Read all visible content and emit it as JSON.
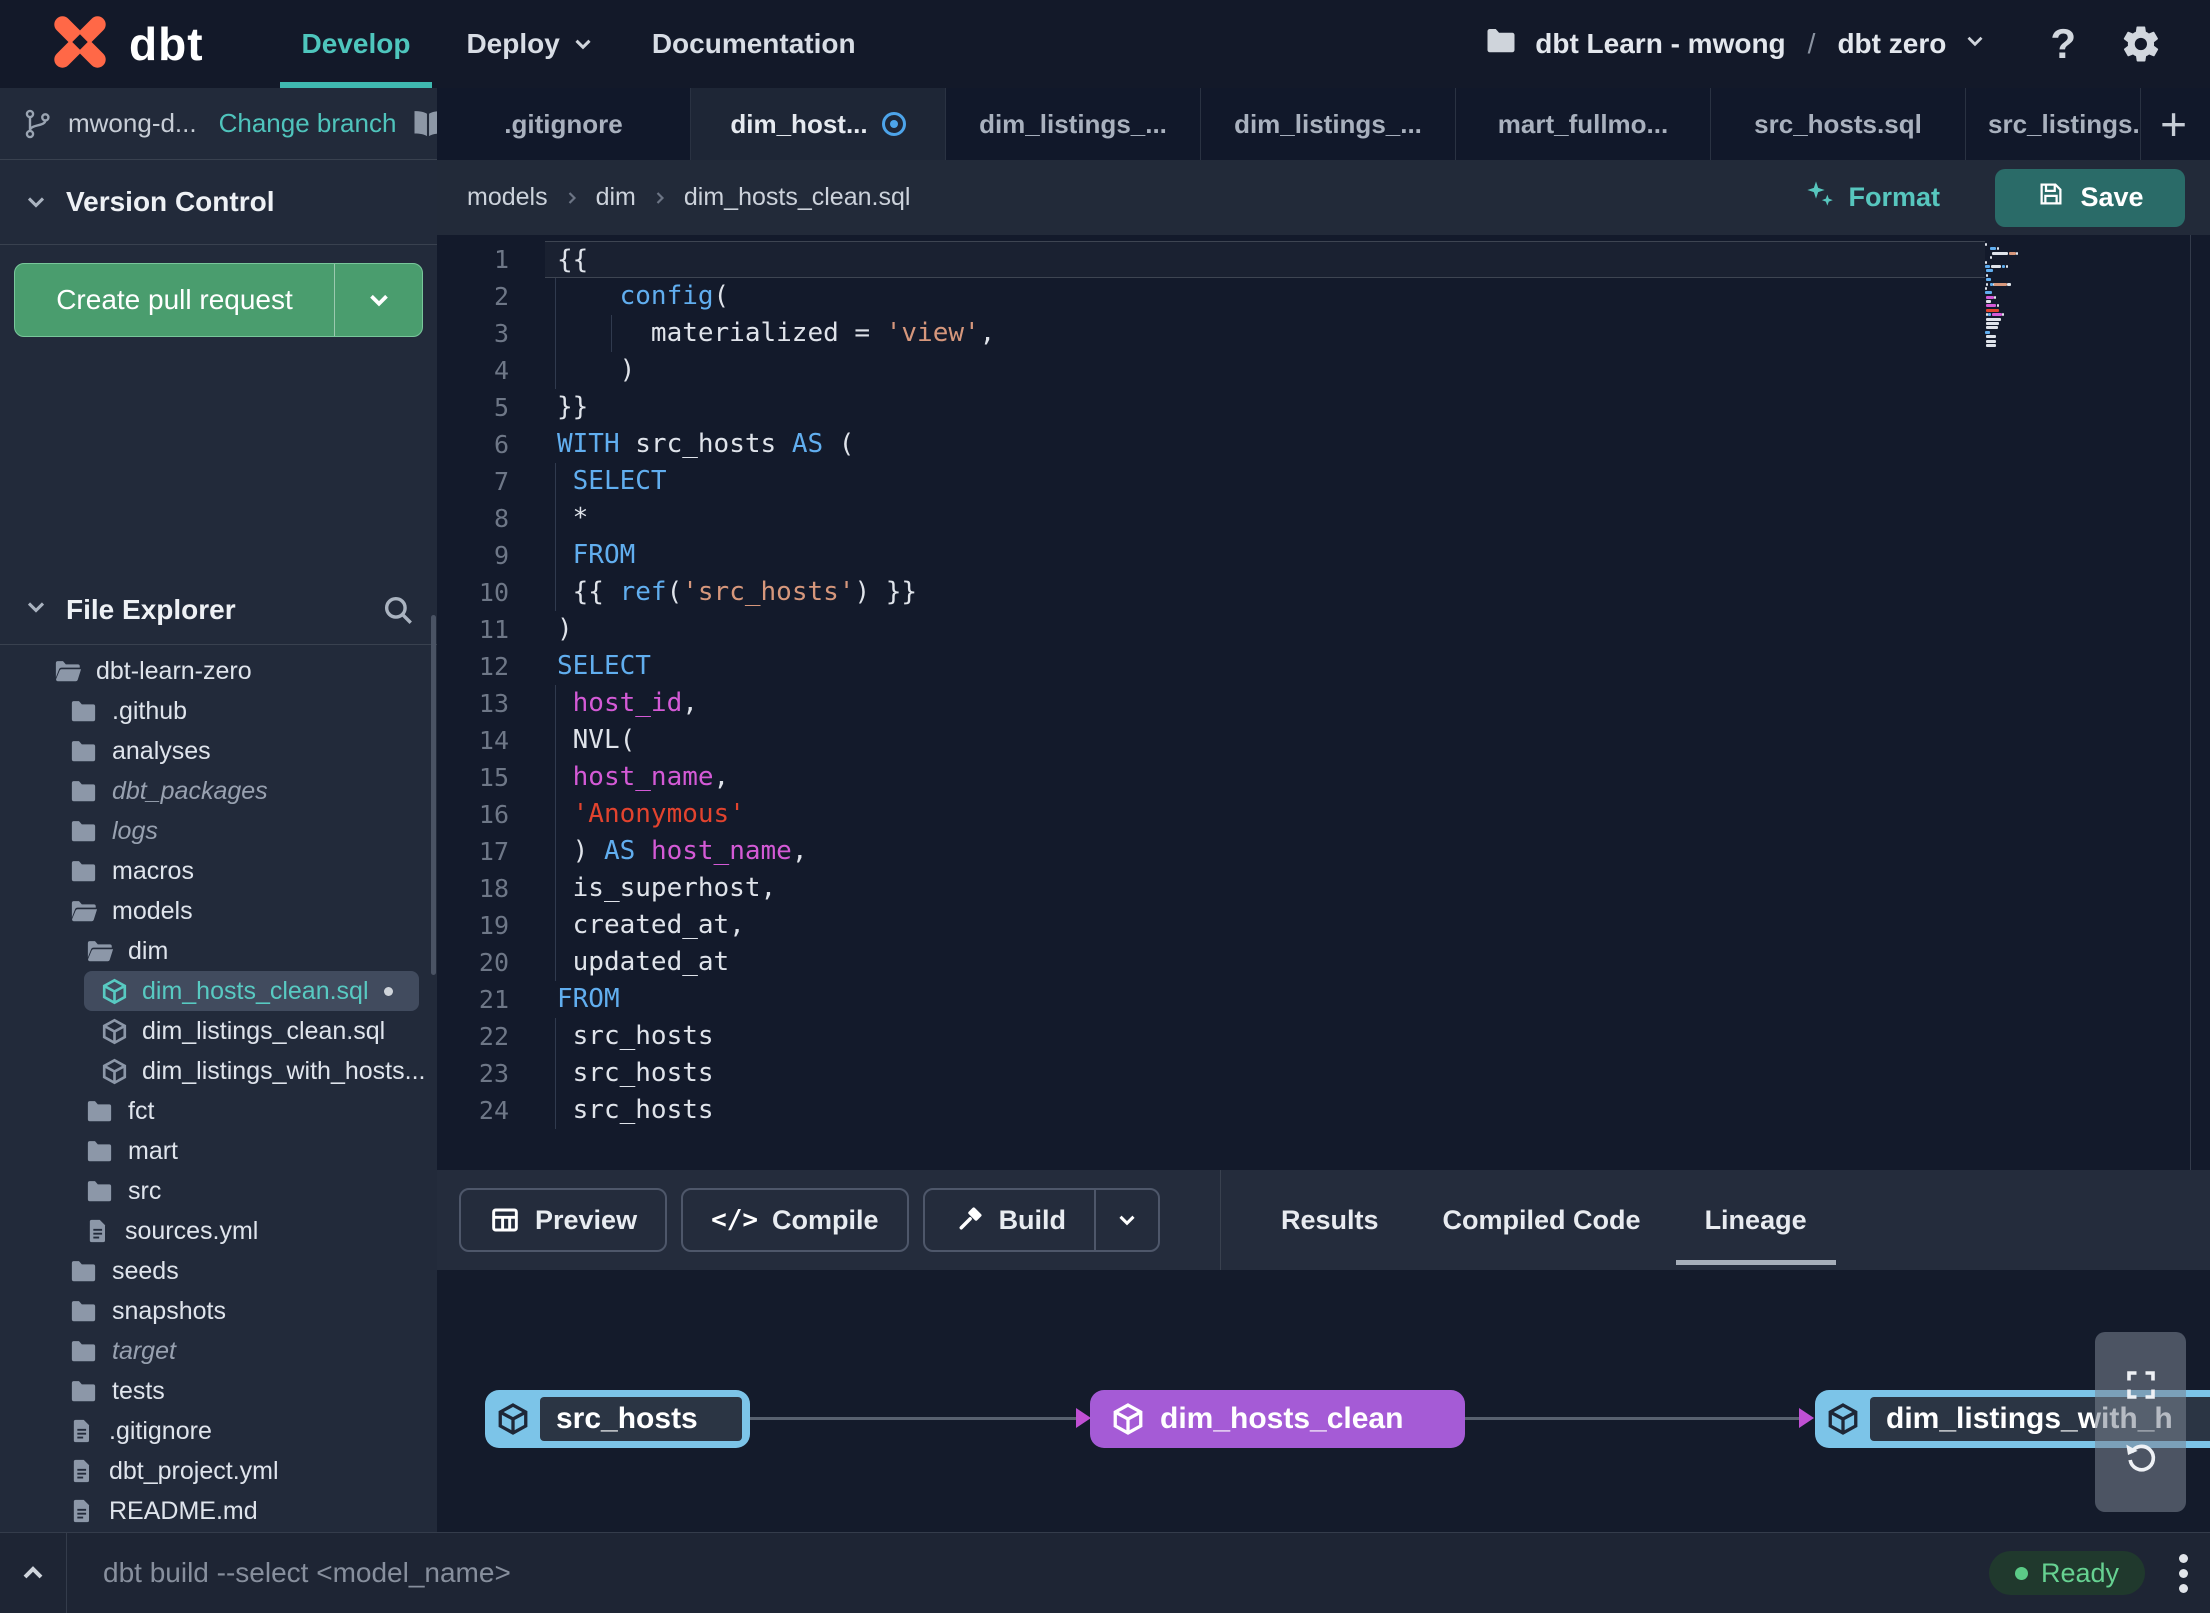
{
  "navbar": {
    "logo_text": "dbt",
    "menu": [
      {
        "label": "Develop",
        "active": true,
        "chevron": false
      },
      {
        "label": "Deploy",
        "active": false,
        "chevron": true
      },
      {
        "label": "Documentation",
        "active": false,
        "chevron": false
      }
    ],
    "project_name": "dbt Learn - mwong",
    "path_separator": "/",
    "environment_name": "dbt zero",
    "help_label": "?"
  },
  "sidebar": {
    "branch_name": "mwong-d...",
    "change_branch_label": "Change branch",
    "version_control_title": "Version Control",
    "create_pull_request_label": "Create pull request",
    "file_explorer_title": "File Explorer",
    "tree": [
      {
        "label": "dbt-learn-zero",
        "type": "folder-open",
        "level": 0
      },
      {
        "label": ".github",
        "type": "folder",
        "level": 1
      },
      {
        "label": "analyses",
        "type": "folder",
        "level": 1
      },
      {
        "label": "dbt_packages",
        "type": "folder",
        "level": 1,
        "italic": true
      },
      {
        "label": "logs",
        "type": "folder",
        "level": 1,
        "italic": true
      },
      {
        "label": "macros",
        "type": "folder",
        "level": 1
      },
      {
        "label": "models",
        "type": "folder-open",
        "level": 1
      },
      {
        "label": "dim",
        "type": "folder-open",
        "level": 2
      },
      {
        "label": "dim_hosts_clean.sql",
        "type": "model",
        "level": 3,
        "selected": true,
        "modified": true
      },
      {
        "label": "dim_listings_clean.sql",
        "type": "model",
        "level": 3
      },
      {
        "label": "dim_listings_with_hosts...",
        "type": "model",
        "level": 3
      },
      {
        "label": "fct",
        "type": "folder",
        "level": 2
      },
      {
        "label": "mart",
        "type": "folder",
        "level": 2
      },
      {
        "label": "src",
        "type": "folder",
        "level": 2
      },
      {
        "label": "sources.yml",
        "type": "file",
        "level": 2
      },
      {
        "label": "seeds",
        "type": "folder",
        "level": 1
      },
      {
        "label": "snapshots",
        "type": "folder",
        "level": 1
      },
      {
        "label": "target",
        "type": "folder",
        "level": 1,
        "italic": true
      },
      {
        "label": "tests",
        "type": "folder",
        "level": 1
      },
      {
        "label": ".gitignore",
        "type": "file",
        "level": 1
      },
      {
        "label": "dbt_project.yml",
        "type": "file",
        "level": 1
      },
      {
        "label": "README.md",
        "type": "file",
        "level": 1
      }
    ]
  },
  "editor": {
    "tabs": [
      {
        "label": ".gitignore"
      },
      {
        "label": "dim_host...",
        "active": true,
        "modified": true
      },
      {
        "label": "dim_listings_..."
      },
      {
        "label": "dim_listings_..."
      },
      {
        "label": "mart_fullmo..."
      },
      {
        "label": "src_hosts.sql"
      },
      {
        "label": "src_listings.",
        "clipped": true
      }
    ],
    "new_tab_label": "+",
    "breadcrumb": [
      "models",
      "dim",
      "dim_hosts_clean.sql"
    ],
    "format_label": "Format",
    "save_label": "Save",
    "code": {
      "token_colors": {
        "p": "#dfe3ea",
        "k": "#61aeef",
        "f": "#d45ad6",
        "s": "#d6977c",
        "r": "#e2432e"
      },
      "lines": [
        {
          "n": 1,
          "current": true,
          "guides": [],
          "t": [
            [
              "{{",
              "p"
            ]
          ]
        },
        {
          "n": 2,
          "guides": [
            0
          ],
          "t": [
            [
              "    ",
              "p"
            ],
            [
              "config",
              "k"
            ],
            [
              "(",
              "p"
            ]
          ]
        },
        {
          "n": 3,
          "guides": [
            0,
            1
          ],
          "t": [
            [
              "      materialized = ",
              "p"
            ],
            [
              "'view'",
              "s"
            ],
            [
              ",",
              "p"
            ]
          ]
        },
        {
          "n": 4,
          "guides": [
            0
          ],
          "t": [
            [
              "    )",
              "p"
            ]
          ]
        },
        {
          "n": 5,
          "guides": [],
          "t": [
            [
              "}}",
              "p"
            ]
          ]
        },
        {
          "n": 6,
          "guides": [],
          "t": [
            [
              "WITH",
              "k"
            ],
            [
              " src_hosts ",
              "p"
            ],
            [
              "AS",
              "k"
            ],
            [
              " (",
              "p"
            ]
          ]
        },
        {
          "n": 7,
          "guides": [
            0
          ],
          "t": [
            [
              " ",
              "p"
            ],
            [
              "SELECT",
              "k"
            ]
          ]
        },
        {
          "n": 8,
          "guides": [
            0
          ],
          "t": [
            [
              " *",
              "p"
            ]
          ]
        },
        {
          "n": 9,
          "guides": [
            0
          ],
          "t": [
            [
              " ",
              "p"
            ],
            [
              "FROM",
              "k"
            ]
          ]
        },
        {
          "n": 10,
          "guides": [
            0
          ],
          "t": [
            [
              " {{ ",
              "p"
            ],
            [
              "ref",
              "k"
            ],
            [
              "(",
              "p"
            ],
            [
              "'src_hosts'",
              "s"
            ],
            [
              ") }}",
              "p"
            ]
          ]
        },
        {
          "n": 11,
          "guides": [],
          "t": [
            [
              ")",
              "p"
            ]
          ]
        },
        {
          "n": 12,
          "guides": [],
          "t": [
            [
              "SELECT",
              "k"
            ]
          ]
        },
        {
          "n": 13,
          "guides": [
            0
          ],
          "t": [
            [
              " ",
              "p"
            ],
            [
              "host_id",
              "f"
            ],
            [
              ",",
              "p"
            ]
          ]
        },
        {
          "n": 14,
          "guides": [
            0
          ],
          "t": [
            [
              " NVL(",
              "p"
            ]
          ]
        },
        {
          "n": 15,
          "guides": [
            0
          ],
          "t": [
            [
              " ",
              "p"
            ],
            [
              "host_name",
              "f"
            ],
            [
              ",",
              "p"
            ]
          ]
        },
        {
          "n": 16,
          "guides": [
            0
          ],
          "t": [
            [
              " ",
              "p"
            ],
            [
              "'Anonymous'",
              "r"
            ]
          ]
        },
        {
          "n": 17,
          "guides": [
            0
          ],
          "t": [
            [
              " ) ",
              "p"
            ],
            [
              "AS",
              "k"
            ],
            [
              " ",
              "p"
            ],
            [
              "host_name",
              "f"
            ],
            [
              ",",
              "p"
            ]
          ]
        },
        {
          "n": 18,
          "guides": [
            0
          ],
          "t": [
            [
              " is_superhost,",
              "p"
            ]
          ]
        },
        {
          "n": 19,
          "guides": [
            0
          ],
          "t": [
            [
              " created_at,",
              "p"
            ]
          ]
        },
        {
          "n": 20,
          "guides": [
            0
          ],
          "t": [
            [
              " updated_at",
              "p"
            ]
          ]
        },
        {
          "n": 21,
          "guides": [],
          "t": [
            [
              "FROM",
              "k"
            ]
          ]
        },
        {
          "n": 22,
          "guides": [
            0
          ],
          "t": [
            [
              " src_hosts",
              "p"
            ]
          ]
        },
        {
          "n": 23,
          "guides": [
            0
          ],
          "t": [
            [
              " src_hosts",
              "p"
            ]
          ]
        },
        {
          "n": 24,
          "guides": [
            0
          ],
          "t": [
            [
              " src_hosts",
              "p"
            ]
          ]
        }
      ]
    }
  },
  "bottom_panel": {
    "actions": [
      {
        "label": "Preview",
        "icon": "grid"
      },
      {
        "label": "Compile",
        "icon": "code"
      },
      {
        "label": "Build",
        "icon": "hammer",
        "split": true
      }
    ],
    "tabs": [
      {
        "label": "Results"
      },
      {
        "label": "Compiled Code"
      },
      {
        "label": "Lineage",
        "active": true
      }
    ],
    "lineage_nodes": [
      {
        "label": "src_hosts",
        "style": "blue"
      },
      {
        "label": "dim_hosts_clean",
        "style": "purple"
      },
      {
        "label": "dim_listings_with_h",
        "style": "blue"
      }
    ]
  },
  "status_bar": {
    "command_text": "dbt build --select <model_name>",
    "status_label": "Ready"
  }
}
